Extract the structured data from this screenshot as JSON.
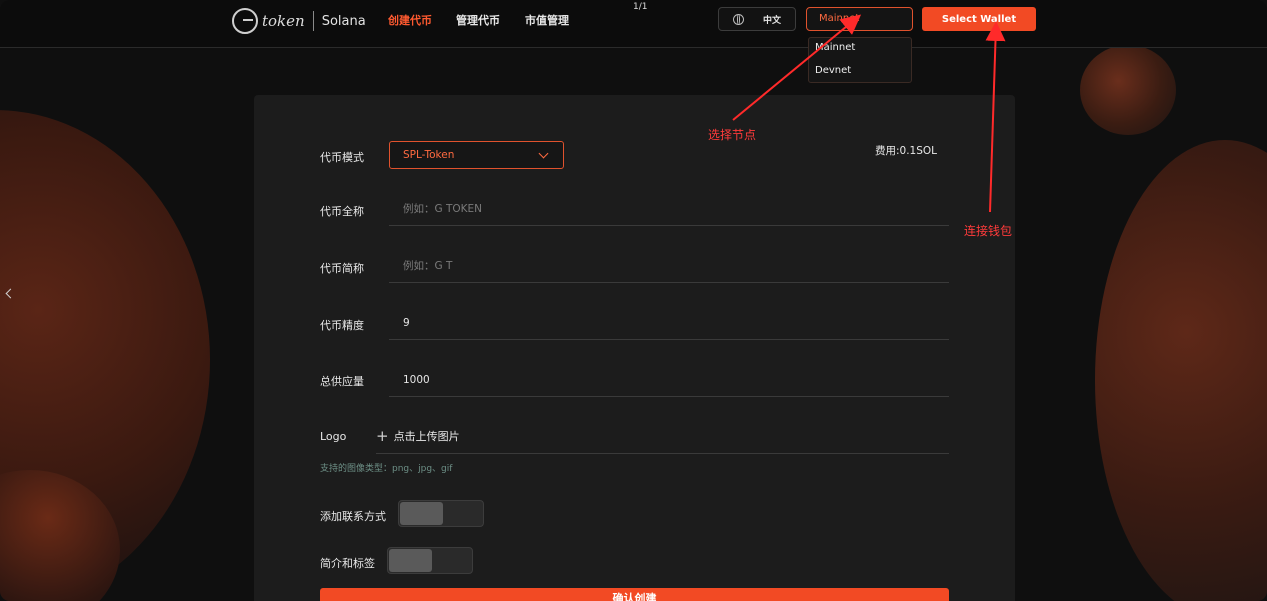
{
  "header": {
    "logo_word": "token",
    "logo_chain": "Solana",
    "nav": [
      "创建代币",
      "管理代币",
      "市值管理"
    ],
    "pager": "1/1",
    "language": "中文",
    "network": {
      "selected": "Mainnet",
      "options": [
        "Mainnet",
        "Devnet"
      ]
    },
    "wallet_button": "Select Wallet"
  },
  "form": {
    "fee": "费用:0.1SOL",
    "mode_label": "代币模式",
    "mode_value": "SPL-Token",
    "name_label": "代币全称",
    "name_placeholder": "例如：G TOKEN",
    "symbol_label": "代币简称",
    "symbol_placeholder": "例如：G T",
    "decimals_label": "代币精度",
    "decimals_value": "9",
    "supply_label": "总供应量",
    "supply_value": "1000",
    "logo_label": "Logo",
    "upload_label": "点击上传图片",
    "upload_hint": "支持的图像类型：png、jpg、gif",
    "contact_label": "添加联系方式",
    "intro_label": "简介和标签",
    "create_button": "确认创建"
  },
  "annotations": {
    "node": "选择节点",
    "wallet": "连接钱包",
    "color": "#ff3b3b"
  },
  "colors": {
    "accent": "#f24a24",
    "background": "#0f0f0f",
    "panel": "#1c1c1c"
  }
}
